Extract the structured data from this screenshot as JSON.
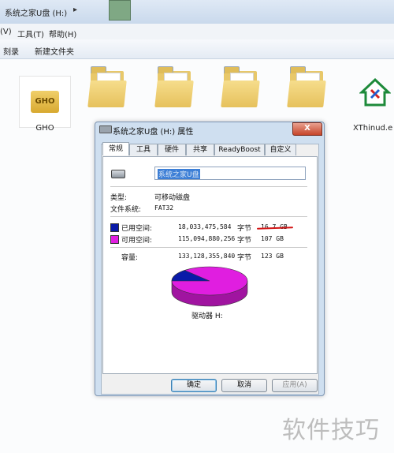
{
  "explorer": {
    "address": "系统之家U盘 (H:)",
    "menu": [
      "(V)",
      "工具(T)",
      "帮助(H)"
    ],
    "toolbar": [
      "刻录",
      "新建文件夹"
    ],
    "files": [
      "GHO",
      "XThinud.e"
    ]
  },
  "dialog": {
    "title": "系统之家U盘 (H:) 属性",
    "close_symbol": "X",
    "tabs": [
      "常规",
      "工具",
      "硬件",
      "共享",
      "ReadyBoost",
      "自定义"
    ],
    "active_tab": "常规",
    "drive_label": "系统之家U盘",
    "type_label": "类型:",
    "type_value": "可移动磁盘",
    "fs_label": "文件系统:",
    "fs_value": "FAT32",
    "used": {
      "label": "已用空间:",
      "bytes": "18,033,475,584",
      "unit": "字节",
      "gb": "16.7 GB",
      "color": "#0a1aa8"
    },
    "free": {
      "label": "可用空间:",
      "bytes": "115,094,880,256",
      "unit": "字节",
      "gb": "107 GB",
      "color": "#e01ee0"
    },
    "capacity": {
      "label": "容量:",
      "bytes": "133,128,355,840",
      "unit": "字节",
      "gb": "123 GB"
    },
    "used_fraction": 0.135,
    "drive_caption": "驱动器 H:",
    "buttons": {
      "ok": "确定",
      "cancel": "取消",
      "apply": "应用(A)"
    }
  },
  "watermark": "软件技巧"
}
